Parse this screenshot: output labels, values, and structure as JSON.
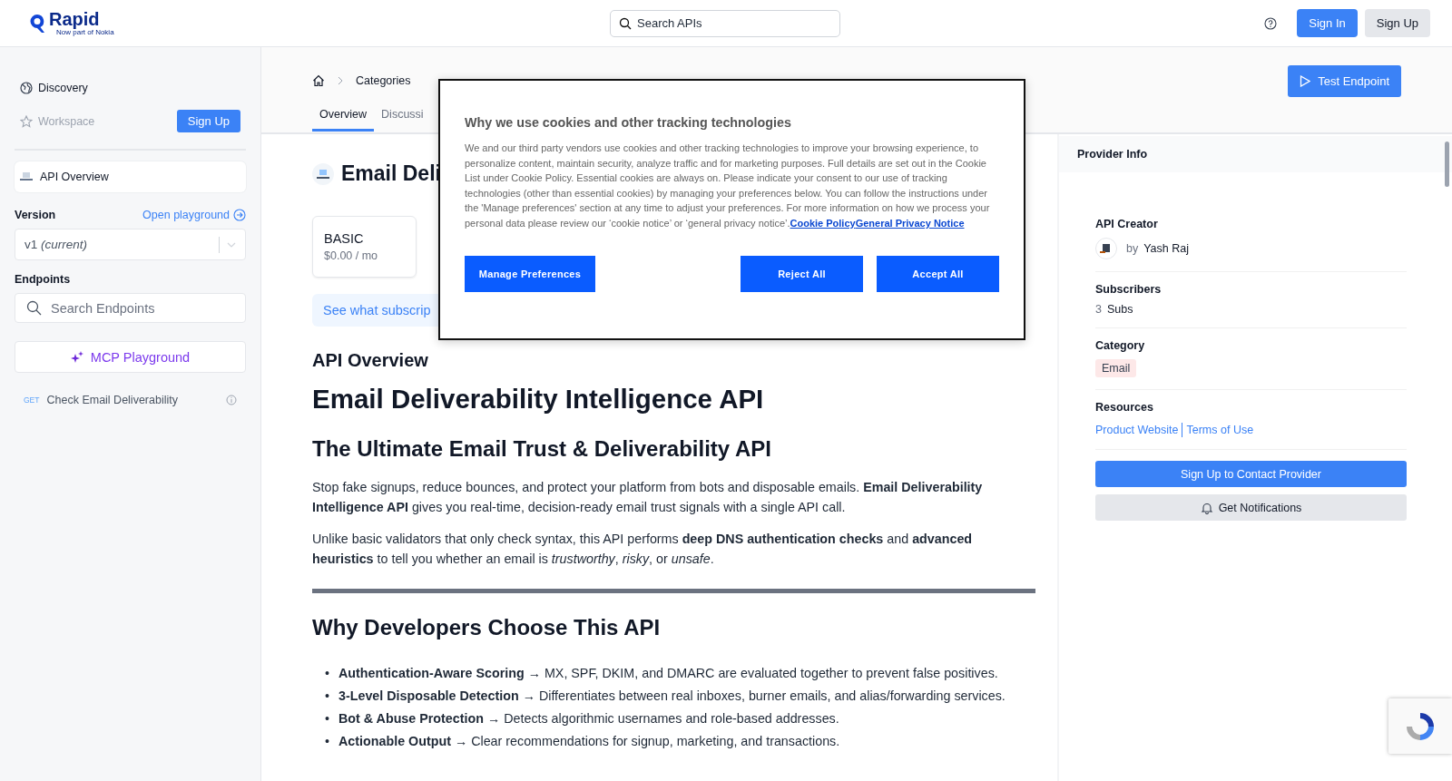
{
  "header": {
    "logo": {
      "name": "Rapid",
      "tagline": "Now part of Nokia"
    },
    "search": {
      "placeholder": "Search APIs"
    },
    "buttons": [
      {
        "label": "Sign In",
        "kind": "primary"
      },
      {
        "label": "Sign Up",
        "kind": "secondary"
      }
    ]
  },
  "sidebar": {
    "nav": [
      {
        "label": "Discovery",
        "disabled": false
      },
      {
        "label": "Workspace",
        "disabled": true
      }
    ],
    "signup": "Sign Up",
    "overview_item": {
      "label": "API Overview"
    },
    "version_label": "Version",
    "playground_link": "Open playground",
    "version_select": {
      "value": "v1 *(current)*"
    },
    "endpoints_label": "Endpoints",
    "endpoint_search": {
      "placeholder": "Search Endpoints"
    },
    "mcp_button": "MCP Playground",
    "endpoints": [
      {
        "method": "GET",
        "name": "Check Email Deliverability"
      }
    ]
  },
  "main": {
    "breadcrumb": [
      "Categories"
    ],
    "tabs": [
      {
        "label": "Overview",
        "selected": true
      },
      {
        "label": "Discussi",
        "selected": false
      }
    ],
    "test_button": "Test Endpoint",
    "title": "Email Deli",
    "plans": [
      {
        "name": "BASIC",
        "price": "$0.00 / mo"
      }
    ],
    "banner": "See what subscrip",
    "content": [
      {
        "kind": "label",
        "text": "API Overview"
      },
      {
        "kind": "h1",
        "text": "Email Deliverability Intelligence API"
      },
      {
        "kind": "h2",
        "text": "The Ultimate Email Trust & Deliverability API"
      },
      {
        "kind": "p",
        "text": "Stop fake signups, reduce bounces, and protect your platform from bots and disposable emails. **Email Deliverability Intelligence API** gives you real-time, decision-ready email trust signals with a single API call."
      },
      {
        "kind": "p",
        "text": "Unlike basic validators that only check syntax, this API performs **deep DNS authentication checks** and **advanced heuristics** to tell you whether an email is *trustworthy*, *risky*, or *unsafe*."
      },
      {
        "kind": "hr"
      },
      {
        "kind": "h2",
        "text": "Why Developers Choose This API"
      },
      {
        "kind": "list",
        "items": [
          {
            "bullet": "•",
            "text": "**Authentication-Aware Scoring** → MX, SPF, DKIM, and DMARC are evaluated together to prevent false positives."
          },
          {
            "bullet": "•",
            "text": "**3-Level Disposable Detection** → Differentiates between real inboxes, burner emails, and alias/forwarding services."
          },
          {
            "bullet": "•",
            "text": "**Bot & Abuse Protection** → Detects algorithmic usernames and role-based addresses."
          },
          {
            "bullet": "•",
            "text": "**Actionable Output** → Clear recommendations for signup, marketing, and transactions."
          }
        ]
      }
    ]
  },
  "provider": {
    "title": "Provider Info",
    "creator_label": "API Creator",
    "by": "by",
    "creator": "Yash Raj",
    "subscribers_label": "Subscribers",
    "subscribers_count": "3",
    "subscribers_unit": "Subs",
    "category_label": "Category",
    "category": {
      "label": "Email",
      "color": "#fde8e8"
    },
    "resources_label": "Resources",
    "links": [
      "Product Website",
      "Terms of Use"
    ],
    "contact_button": "Sign Up to Contact Provider",
    "notify_button": "Get Notifications"
  },
  "cookie_dialog": {
    "title": "Why we use cookies and other tracking technologies",
    "text": "We and our third party vendors use cookies and other tracking technologies to improve your browsing experience, to personalize content, maintain security, analyze traffic and for marketing purposes. Full details are set out in the Cookie List under Cookie Policy. Essential cookies are always on. Please indicate your consent to our use of tracking technologies (other than essential cookies) by managing your preferences below. You can follow the instructions under the 'Manage preferences' section at any time to adjust your preferences. For more information on how we process your personal data please review our ‘cookie notice’ or ‘general privacy notice’.",
    "links": [
      "Cookie Policy",
      "General Privacy Notice"
    ],
    "buttons": [
      "Manage Preferences",
      "Reject All",
      "Accept All"
    ]
  }
}
